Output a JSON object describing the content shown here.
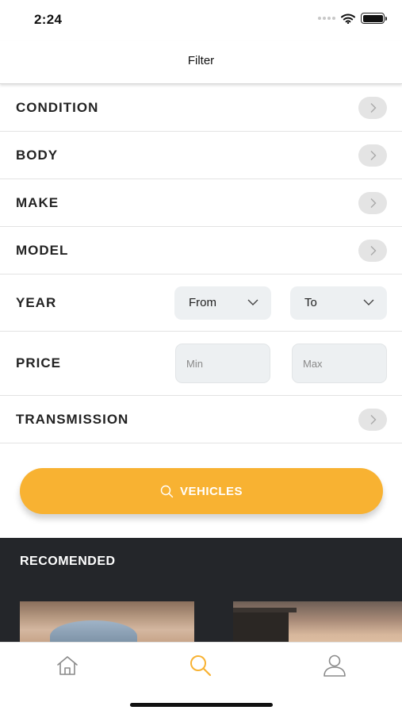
{
  "status": {
    "time": "2:24"
  },
  "header": {
    "title": "Filter"
  },
  "filters": {
    "condition": "CONDITION",
    "body": "BODY",
    "make": "MAKE",
    "model": "MODEL",
    "year": {
      "label": "YEAR",
      "from": "From",
      "to": "To"
    },
    "price": {
      "label": "PRICE",
      "min_placeholder": "Min",
      "max_placeholder": "Max"
    },
    "transmission": "TRANSMISSION"
  },
  "cta": {
    "label": "VEHICLES"
  },
  "recommended": {
    "title": "RECOMENDED"
  },
  "tabs": [
    {
      "icon": "home-icon"
    },
    {
      "icon": "search-icon",
      "active": true
    },
    {
      "icon": "profile-icon"
    }
  ],
  "colors": {
    "accent": "#f8b232",
    "dark": "#24262a",
    "field_bg": "#edf0f2",
    "chevron_bg": "#e4e4e4"
  }
}
